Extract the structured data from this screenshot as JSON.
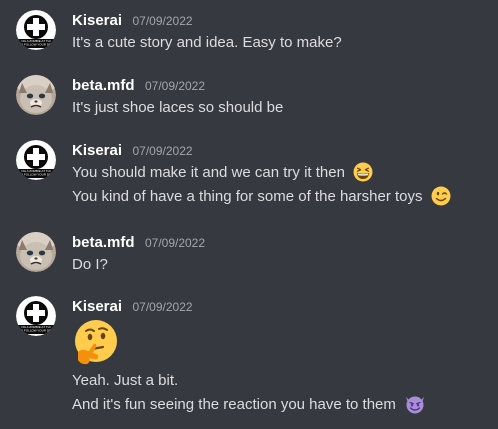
{
  "messages": [
    {
      "username": "Kiserai",
      "timestamp": "07/09/2022",
      "lines": [
        "It's a cute story and idea. Easy to make?"
      ]
    },
    {
      "username": "beta.mfd",
      "timestamp": "07/09/2022",
      "lines": [
        "It's just shoe laces so should be"
      ]
    },
    {
      "username": "Kiserai",
      "timestamp": "07/09/2022",
      "lines": [
        "You should make it and we can try it then",
        "You kind of have a thing for some of the harsher toys"
      ],
      "line_emojis": [
        "grinning-squinting-face",
        "winking-face"
      ]
    },
    {
      "username": "beta.mfd",
      "timestamp": "07/09/2022",
      "lines": [
        "Do I?"
      ]
    },
    {
      "username": "Kiserai",
      "timestamp": "07/09/2022",
      "big_emoji": "thinking-face",
      "lines": [
        "Yeah. Just a bit.",
        "And it's fun seeing the reaction you have to them"
      ],
      "line_emojis": [
        "",
        "smiling-face-with-horns"
      ]
    }
  ],
  "avatar_text": {
    "kiserai": "NG A ZOMBIE AT THI\nD FOLLOW YOUR DR"
  },
  "colors": {
    "background": "#36393f",
    "username": "#ffffff",
    "timestamp": "#a3a6aa",
    "message_text": "#dcddde",
    "emoji_yellow": "#ffcc4d",
    "emoji_purple": "#aa8dd8"
  }
}
